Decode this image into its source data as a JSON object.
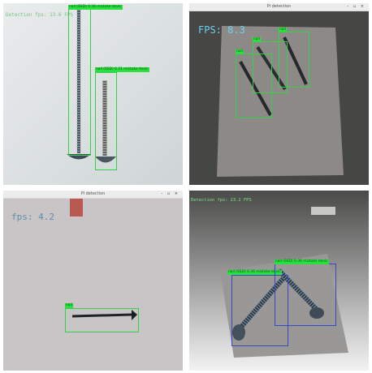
{
  "panels": [
    {
      "fps": "Detection fps: 13.6 FPS",
      "labels": [
        "nail (SSD) 0.36 mistake devic",
        "nail (SSD) 0.31 mistake devic"
      ]
    },
    {
      "window_title": "Pi detection",
      "window_controls": "- ▫ ×",
      "fps": "FPS: 8.3",
      "labels": [
        "nail",
        "nail",
        "nail"
      ]
    },
    {
      "window_title": "Pi detection",
      "window_controls": "- ▫ ×",
      "fps": "fps: 4.2",
      "labels": [
        "nail"
      ]
    },
    {
      "fps": "Detection fps: 23.2 FPS",
      "labels": [
        "nail (SSD) 0.36 mistake devic",
        "nail (SSD) 0.36 mistake devic"
      ]
    }
  ]
}
